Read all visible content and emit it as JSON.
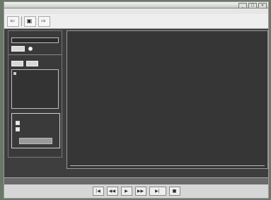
{
  "window": {
    "title": ""
  },
  "menu": {
    "items": [
      "",
      "",
      "",
      "",
      "",
      "",
      "",
      ""
    ]
  },
  "toolbar": {
    "buttons": [
      {
        "label": "",
        "icon": "arrow-left-icon"
      },
      {
        "label": "",
        "icon": "image-icon"
      },
      {
        "label": "",
        "icon": "arrow-right-icon"
      }
    ]
  },
  "left_panel": {
    "section1_label": "",
    "input_value": "",
    "button1": "",
    "radio_label": "",
    "section2_label": "",
    "button2": "",
    "button3": "",
    "list_item": "",
    "group_label": "",
    "check1": "",
    "check2": "",
    "bottom_button": ""
  },
  "main_panel": {
    "label": ""
  },
  "status": {
    "left": "",
    "right": ""
  },
  "player": {
    "buttons": [
      "|◀",
      "◀◀",
      "▶",
      "▶▶",
      "▶|",
      "■"
    ]
  }
}
